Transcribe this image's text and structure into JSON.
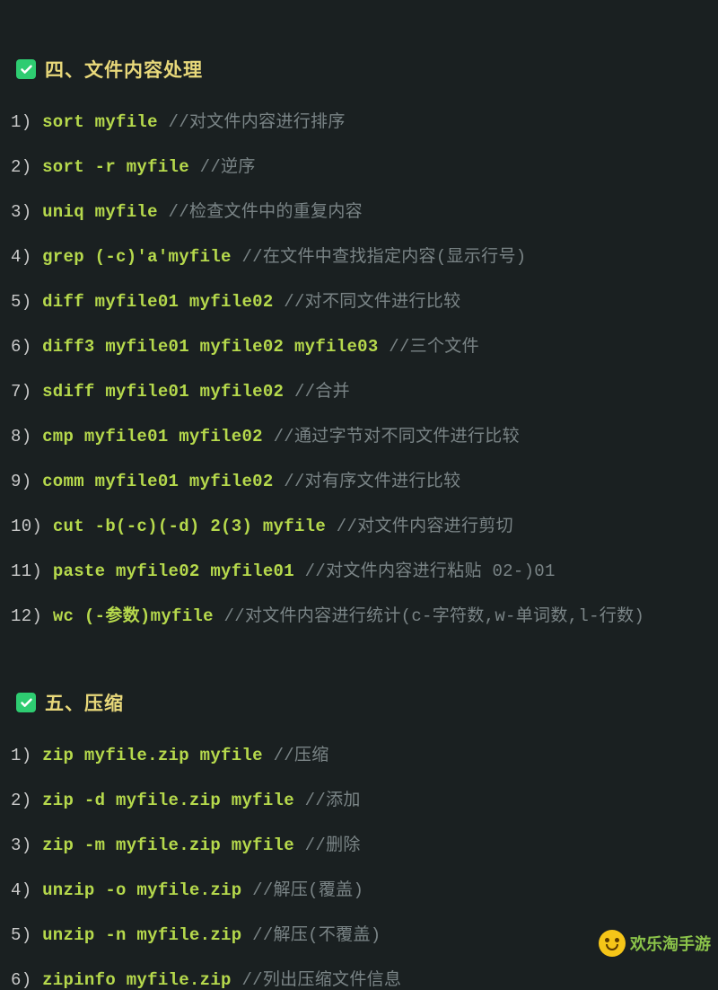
{
  "sections": [
    {
      "title": "四、文件内容处理",
      "items": [
        {
          "num": "1)",
          "cmd": "sort myfile",
          "comment": "//对文件内容进行排序"
        },
        {
          "num": "2)",
          "cmd": "sort -r myfile",
          "comment": "//逆序"
        },
        {
          "num": "3)",
          "cmd": "uniq myfile",
          "comment": "//检查文件中的重复内容"
        },
        {
          "num": "4)",
          "cmd": "grep (-c)'a'myfile",
          "comment": "//在文件中查找指定内容(显示行号)"
        },
        {
          "num": "5)",
          "cmd": "diff myfile01 myfile02",
          "comment": "//对不同文件进行比较"
        },
        {
          "num": "6)",
          "cmd": "diff3 myfile01 myfile02 myfile03",
          "comment": "//三个文件"
        },
        {
          "num": "7)",
          "cmd": "sdiff myfile01 myfile02",
          "comment": "//合并"
        },
        {
          "num": "8)",
          "cmd": "cmp myfile01 myfile02",
          "comment": "//通过字节对不同文件进行比较"
        },
        {
          "num": "9)",
          "cmd": "comm myfile01 myfile02",
          "comment": "//对有序文件进行比较"
        },
        {
          "num": "10)",
          "cmd": "cut -b(-c)(-d) 2(3) myfile",
          "comment": "//对文件内容进行剪切"
        },
        {
          "num": "11)",
          "cmd": "paste myfile02 myfile01",
          "comment": "//对文件内容进行粘贴 02-)01"
        },
        {
          "num": "12)",
          "cmd": "wc (-参数)myfile",
          "comment": "//对文件内容进行统计(c-字符数,w-单词数,l-行数)"
        }
      ]
    },
    {
      "title": "五、压缩",
      "items": [
        {
          "num": "1)",
          "cmd": "zip myfile.zip myfile",
          "comment": "//压缩"
        },
        {
          "num": "2)",
          "cmd": "zip -d myfile.zip myfile",
          "comment": "//添加"
        },
        {
          "num": "3)",
          "cmd": "zip -m myfile.zip myfile",
          "comment": "//删除"
        },
        {
          "num": "4)",
          "cmd": "unzip -o myfile.zip ",
          "comment": "//解压(覆盖)"
        },
        {
          "num": "5)",
          "cmd": "unzip -n myfile.zip",
          "comment": "//解压(不覆盖)"
        },
        {
          "num": "6)",
          "cmd": "zipinfo myfile.zip",
          "comment": "//列出压缩文件信息"
        }
      ]
    }
  ],
  "watermark": "欢乐淘手游"
}
